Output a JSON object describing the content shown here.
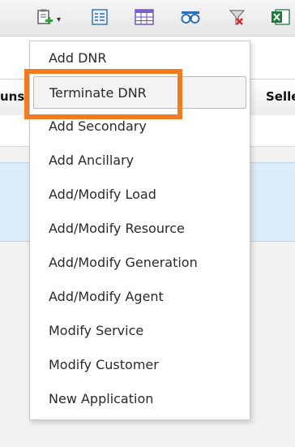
{
  "toolbar": {
    "icons": [
      "clipboard-add-icon",
      "form-view-icon",
      "grid-view-icon",
      "binoculars-icon",
      "clear-filter-icon",
      "excel-export-icon"
    ]
  },
  "grid": {
    "header_left": "uns",
    "header_right": "Seller"
  },
  "menu": {
    "items": [
      {
        "label": "Add DNR"
      },
      {
        "label": "Terminate DNR"
      },
      {
        "label": "Add Secondary"
      },
      {
        "label": "Add Ancillary"
      },
      {
        "label": "Add/Modify Load"
      },
      {
        "label": "Add/Modify Resource"
      },
      {
        "label": "Add/Modify Generation"
      },
      {
        "label": "Add/Modify Agent"
      },
      {
        "label": "Modify Service"
      },
      {
        "label": "Modify Customer"
      },
      {
        "label": "New Application"
      }
    ],
    "hovered_item": "Terminate DNR"
  },
  "colors": {
    "highlight": "#f47a20",
    "selected_row": "#dcecf8"
  }
}
